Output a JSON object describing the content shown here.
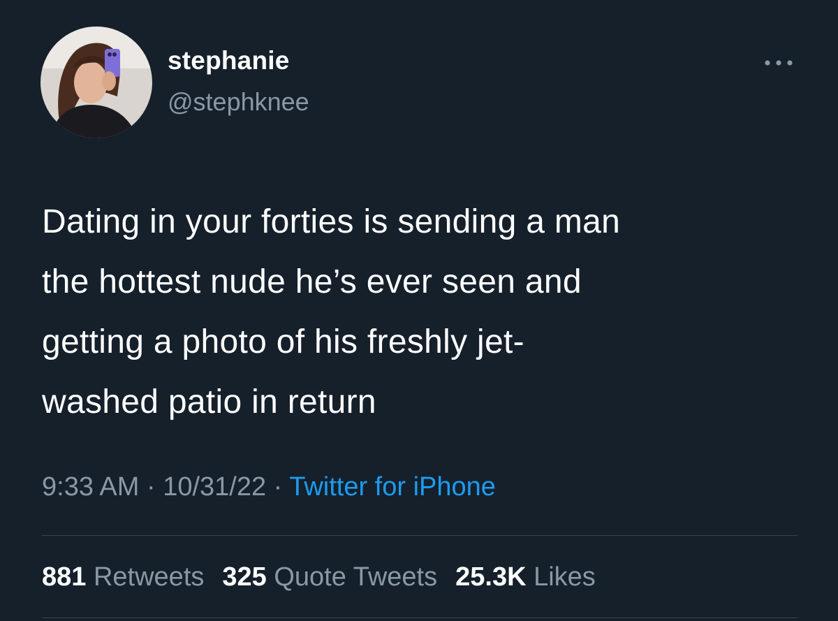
{
  "user": {
    "display_name": "stephanie",
    "handle": "@stephknee"
  },
  "tweet": {
    "text": "Dating in your forties is sending a man\nthe hottest nude he’s ever seen and\ngetting a photo of his freshly jet-\nwashed patio in return",
    "time": "9:33 AM",
    "date": "10/31/22",
    "separator": " · ",
    "source": "Twitter for iPhone"
  },
  "stats": {
    "retweets_count": "881",
    "retweets_label": "Retweets",
    "quotes_count": "325",
    "quotes_label": "Quote Tweets",
    "likes_count": "25.3K",
    "likes_label": "Likes"
  },
  "icons": {
    "more": "more-icon"
  },
  "colors": {
    "background": "#15202b",
    "text_primary": "#ffffff",
    "text_secondary": "#8b98a5",
    "link": "#1d9bf0",
    "divider": "#38444d"
  }
}
